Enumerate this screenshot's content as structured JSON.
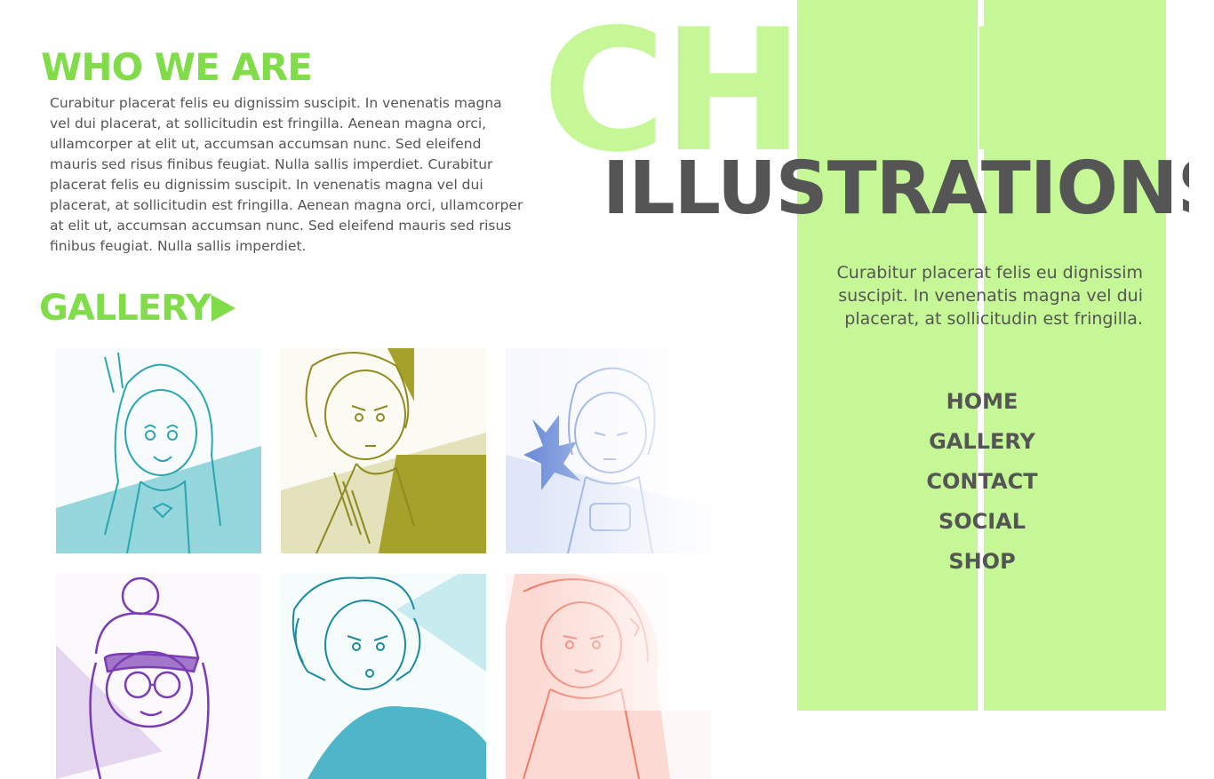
{
  "hero": {
    "title_top": "CHILL",
    "title_bottom": "ILLUSTRATIONS",
    "description": "Curabitur placerat felis eu dignissim suscipit. In venenatis magna vel dui placerat, at sollicitudin est fringilla."
  },
  "nav": {
    "items": [
      {
        "label": "HOME"
      },
      {
        "label": "GALLERY"
      },
      {
        "label": "CONTACT"
      },
      {
        "label": "SOCIAL"
      },
      {
        "label": "SHOP"
      }
    ]
  },
  "about": {
    "heading": "WHO WE ARE",
    "body": "Curabitur placerat felis eu dignissim suscipit. In venenatis magna vel dui placerat, at sollicitudin est fringilla. Aenean magna orci, ullamcorper at elit ut, accumsan accumsan nunc. Sed eleifend mauris sed risus finibus feugiat. Nulla sallis imperdiet. Curabitur placerat felis eu dignissim suscipit. In venenatis magna vel dui placerat, at sollicitudin est fringilla. Aenean magna orci, ullamcorper at elit ut, accumsan accumsan nunc. Sed eleifend mauris sed risus finibus feugiat. Nulla sallis imperdiet."
  },
  "gallery": {
    "heading": "GALLERY",
    "arrow_icon": "play-arrow-icon",
    "thumbnails": [
      {
        "subject": "girl-with-long-hair",
        "color": "#2aa6b2"
      },
      {
        "subject": "boy-thinking",
        "color": "#a6a12a"
      },
      {
        "subject": "spiky-hair-character",
        "color": "#6f8fd8"
      },
      {
        "subject": "girl-with-goggles",
        "color": "#7a3bb4"
      },
      {
        "subject": "boy-holding-head",
        "color": "#1fa0b8"
      },
      {
        "subject": "girl-smiling",
        "color": "#f07a66"
      }
    ]
  },
  "colors": {
    "accent_green": "#80dc49",
    "panel_green": "#c5f796",
    "text_dark": "#555555"
  }
}
